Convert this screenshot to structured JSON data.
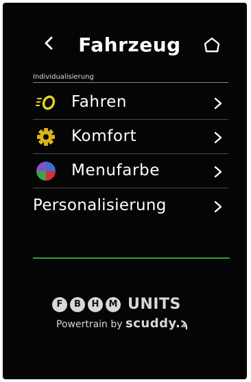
{
  "header": {
    "title": "Fahrzeug",
    "back_icon": "chevron-left-icon",
    "home_icon": "home-icon"
  },
  "section": {
    "label": "Individualisierung"
  },
  "menu": {
    "items": [
      {
        "label": "Fahren",
        "icon": "drive-mode-icon"
      },
      {
        "label": "Komfort",
        "icon": "gear-icon"
      },
      {
        "label": "Menufarbe",
        "icon": "color-wheel-icon"
      },
      {
        "label": "Personalisierung",
        "icon": ""
      }
    ],
    "chevron_icon": "chevron-right-icon"
  },
  "brand": {
    "letters": [
      "F",
      "B",
      "H",
      "M"
    ],
    "units": "UNITS",
    "tagline": "Powertrain by",
    "maker": "scuddy.ϡ"
  },
  "colors": {
    "background": "#050505",
    "text": "#ffffff",
    "accent_yellow": "#e6d21c",
    "gear_yellow": "#d8b417",
    "progress_green": "#2ea23a",
    "brand_gray": "#d8d8d8",
    "wheel_blue": "#3b6fd6",
    "wheel_red": "#d7303a",
    "wheel_green": "#3fa24a",
    "wheel_purple": "#8a4fc8"
  }
}
